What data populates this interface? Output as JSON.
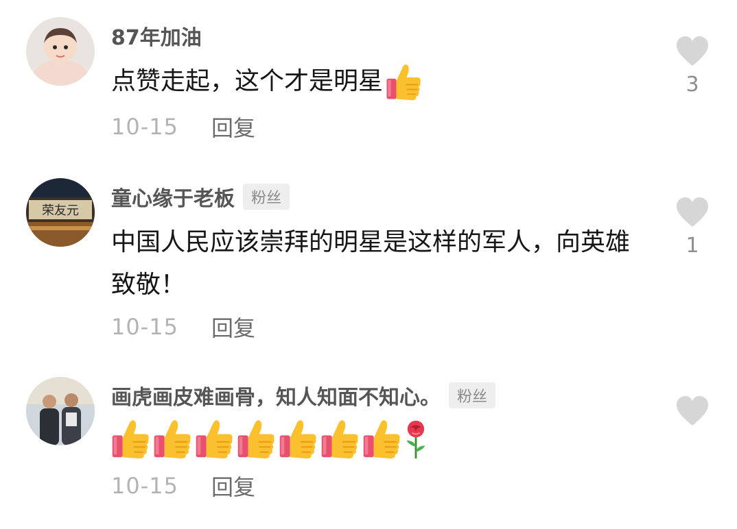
{
  "comments": [
    {
      "username": "87年加油",
      "badge": "",
      "text": "点赞走起，这个才是明星",
      "text_emoji": "thumbs-up",
      "date": "10-15",
      "reply_label": "回复",
      "like_count": "3"
    },
    {
      "username": "童心缘于老板",
      "badge": "粉丝",
      "text": "中国人民应该崇拜的明星是这样的军人，向英雄致敬！",
      "date": "10-15",
      "reply_label": "回复",
      "like_count": "1"
    },
    {
      "username": "画虎画皮难画骨，知人知面不知心。",
      "badge": "粉丝",
      "emojis": [
        "thumbs-up",
        "thumbs-up",
        "thumbs-up",
        "thumbs-up",
        "thumbs-up",
        "thumbs-up",
        "thumbs-up",
        "rose"
      ],
      "date": "10-15",
      "reply_label": "回复",
      "like_count": ""
    }
  ],
  "colors": {
    "username": "#555555",
    "text": "#161616",
    "date": "#b3b3b3",
    "reply": "#6b6b6b",
    "heart": "#d6d6d6",
    "badge_bg": "#eeeeee"
  }
}
